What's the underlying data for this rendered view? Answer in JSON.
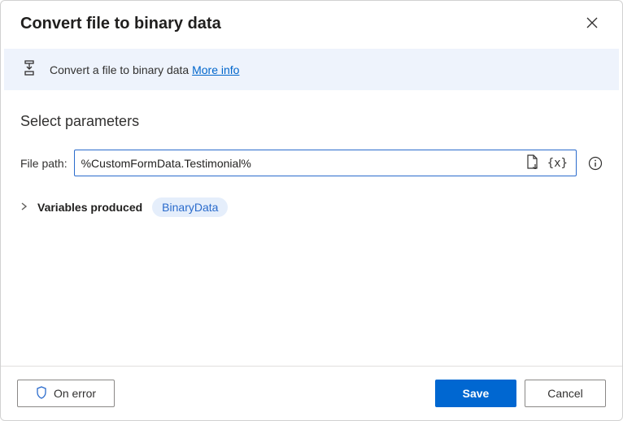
{
  "header": {
    "title": "Convert file to binary data"
  },
  "banner": {
    "text": "Convert a file to binary data ",
    "link": "More info"
  },
  "params": {
    "section_title": "Select parameters",
    "file_path_label": "File path:",
    "file_path_value": "%CustomFormData.Testimonial%"
  },
  "variables": {
    "label": "Variables produced",
    "produced": "BinaryData"
  },
  "footer": {
    "on_error": "On error",
    "save": "Save",
    "cancel": "Cancel"
  }
}
